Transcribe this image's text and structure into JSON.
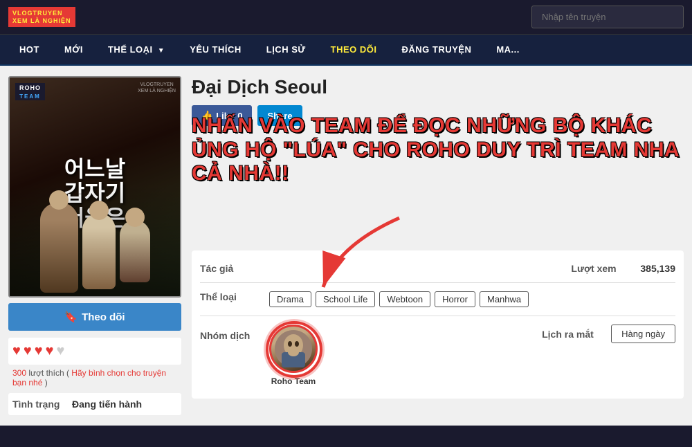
{
  "header": {
    "logo_line1": "VLOGTRUYEN",
    "logo_line2": "XEM LÀ NGHIỆN",
    "search_placeholder": "Nhập tên truyện"
  },
  "nav": {
    "items": [
      {
        "label": "HOT",
        "active": false
      },
      {
        "label": "MỚI",
        "active": false
      },
      {
        "label": "THỂ LOẠI",
        "active": false,
        "has_chevron": true
      },
      {
        "label": "YÊU THÍCH",
        "active": false
      },
      {
        "label": "LỊCH SỬ",
        "active": false
      },
      {
        "label": "THEO DÕI",
        "active": true
      },
      {
        "label": "ĐĂNG TRUYỆN",
        "active": false
      },
      {
        "label": "MA...",
        "active": false
      }
    ]
  },
  "manga": {
    "title": "Đại Dịch Seoul",
    "cover_korean": "어느날\n갑자기\n서울은",
    "cover_team_badge": "ROHO\nTEAM",
    "watermark_line1": "VLOGTRUYEN",
    "watermark_line2": "XEM LÀ NGHIỆN",
    "like_label": "Like",
    "like_count": "0",
    "share_label": "Share",
    "promo_text": "NHẤN VÀO TEAM ĐỂ ĐỌC NHỮNG BỘ KHÁC ỦNG HỘ \"LÚA\" CHO ROHO DUY TRÌ TEAM NHA CẢ NHÀ!!",
    "author_label": "Tác giả",
    "author_value": "",
    "genre_label": "Thể loại",
    "genres": [
      "Drama",
      "School Life",
      "Webtoon",
      "Horror",
      "Manhwa"
    ],
    "translator_label": "Nhóm dịch",
    "translator_name": "Roho Team",
    "views_label": "Lượt xem",
    "views_value": "385,139",
    "release_label": "Lịch ra mắt",
    "release_value": "Hàng ngày",
    "follow_label": "Theo dõi",
    "rating_hearts": 4,
    "rating_total": 5,
    "rating_count": "300",
    "rating_hint": "Hãy bình chọn cho truyện bạn nhé",
    "status_label": "Tình trạng",
    "status_value": "Đang tiến hành"
  }
}
